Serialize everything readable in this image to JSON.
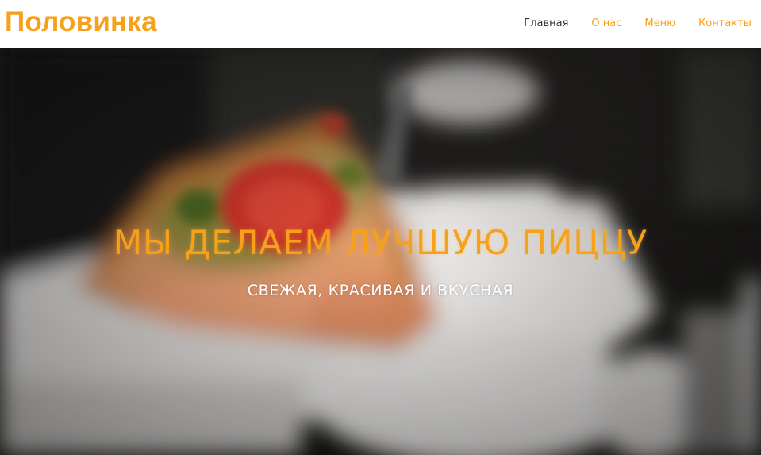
{
  "header": {
    "logo": "Половинка",
    "nav": [
      {
        "label": "Главная",
        "active": true
      },
      {
        "label": "О нас",
        "active": false
      },
      {
        "label": "Меню",
        "active": false
      },
      {
        "label": "Контакты",
        "active": false
      }
    ]
  },
  "hero": {
    "title": "МЫ ДЕЛАЕМ ЛУЧШУЮ ПИЦЦУ",
    "subtitle": "СВЕЖАЯ, КРАСИВАЯ И ВКУСНАЯ"
  },
  "colors": {
    "accent": "#f7a11a",
    "nav_active": "#333333",
    "header_bg": "#ffffff"
  }
}
